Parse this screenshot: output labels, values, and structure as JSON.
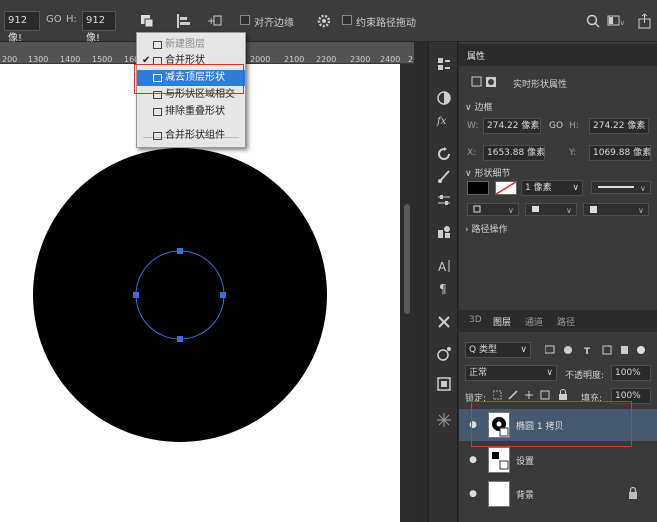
{
  "options_bar": {
    "width_value": "912 像!",
    "link_glyph": "GO",
    "height_label": "H:",
    "height_value": "912 像!",
    "align_edges_label": "对齐边缘",
    "constrain_path_label": "约束路径拖动",
    "right_icons": [
      "search-icon",
      "workspace-icon",
      "share-icon"
    ]
  },
  "ruler": {
    "ticks": [
      "200",
      "1300",
      "1400",
      "1500",
      "160",
      "2000",
      "2100",
      "2200",
      "2300",
      "2400",
      "2"
    ]
  },
  "path_ops_menu": {
    "items": [
      {
        "label": "新建图层",
        "disabled": true,
        "checked": false
      },
      {
        "label": "合并形状",
        "disabled": false,
        "checked": true
      },
      {
        "label": "减去顶层形状",
        "disabled": false,
        "checked": false,
        "highlighted": true
      },
      {
        "label": "与形状区域相交",
        "disabled": false,
        "checked": false
      },
      {
        "label": "排除重叠形状",
        "disabled": false,
        "checked": false
      },
      {
        "label": "合并形状组件",
        "disabled": false,
        "checked": false
      }
    ]
  },
  "properties": {
    "tab": "属性",
    "kind": "实时形状属性",
    "section_bounds": "边框",
    "w_label": "W:",
    "w_value": "274.22 像素",
    "link_glyph": "GO",
    "h_label": "H:",
    "h_value": "274.22 像素",
    "x_label": "X:",
    "x_value": "1653.88 像素",
    "y_label": "Y:",
    "y_value": "1069.88 像素",
    "section_shape": "形状细节",
    "stroke_width": "1 像素",
    "section_path_ops": "路径操作"
  },
  "layers_panel": {
    "tabs": [
      "3D",
      "图层",
      "通道",
      "路径"
    ],
    "active_tab": "图层",
    "filter_label": "Q 类型",
    "blend_mode": "正常",
    "opacity_label": "不透明度:",
    "opacity_value": "100%",
    "lock_label": "锁定:",
    "fill_label": "填充:",
    "fill_value": "100%",
    "layers": [
      {
        "name": "椭圆 1 拷贝",
        "selected": true
      },
      {
        "name": "设置",
        "selected": false
      },
      {
        "name": "背景",
        "selected": false,
        "locked": true
      }
    ]
  },
  "colors": {
    "accent": "#2f7ed8",
    "selection_outline": "#e03030",
    "circle": "#000000",
    "path": "#3a6fd8"
  }
}
